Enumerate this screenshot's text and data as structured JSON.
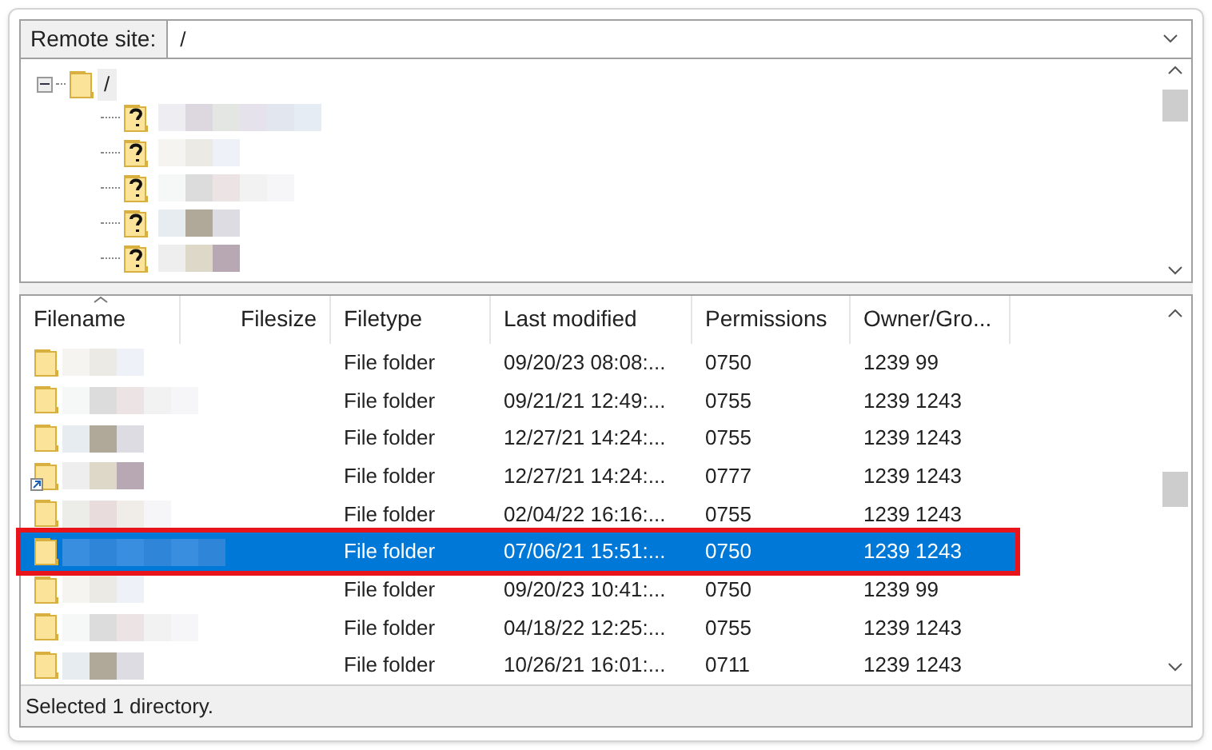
{
  "remote_site": {
    "label": "Remote site:",
    "value": "/"
  },
  "tree": {
    "root": {
      "label": "/",
      "expanded": true,
      "children": [
        {
          "kind": "unknown"
        },
        {
          "kind": "unknown"
        },
        {
          "kind": "unknown"
        },
        {
          "kind": "unknown"
        },
        {
          "kind": "unknown"
        }
      ]
    }
  },
  "table": {
    "columns": [
      "Filename",
      "Filesize",
      "Filetype",
      "Last modified",
      "Permissions",
      "Owner/Gro..."
    ],
    "rows": [
      {
        "selected": false,
        "symlink": false,
        "filetype": "File folder",
        "last_modified": "09/20/23 08:08:...",
        "permissions": "0750",
        "owner": "1239 99"
      },
      {
        "selected": false,
        "symlink": false,
        "filetype": "File folder",
        "last_modified": "09/21/21 12:49:...",
        "permissions": "0755",
        "owner": "1239 1243"
      },
      {
        "selected": false,
        "symlink": false,
        "filetype": "File folder",
        "last_modified": "12/27/21 14:24:...",
        "permissions": "0755",
        "owner": "1239 1243"
      },
      {
        "selected": false,
        "symlink": true,
        "filetype": "File folder",
        "last_modified": "12/27/21 14:24:...",
        "permissions": "0777",
        "owner": "1239 1243"
      },
      {
        "selected": false,
        "symlink": false,
        "filetype": "File folder",
        "last_modified": "02/04/22 16:16:...",
        "permissions": "0755",
        "owner": "1239 1243"
      },
      {
        "selected": true,
        "symlink": false,
        "filetype": "File folder",
        "last_modified": "07/06/21 15:51:...",
        "permissions": "0750",
        "owner": "1239 1243"
      },
      {
        "selected": false,
        "symlink": false,
        "filetype": "File folder",
        "last_modified": "09/20/23 10:41:...",
        "permissions": "0750",
        "owner": "1239 99"
      },
      {
        "selected": false,
        "symlink": false,
        "filetype": "File folder",
        "last_modified": "04/18/22 12:25:...",
        "permissions": "0755",
        "owner": "1239 1243"
      },
      {
        "selected": false,
        "symlink": false,
        "filetype": "File folder",
        "last_modified": "10/26/21 16:01:...",
        "permissions": "0711",
        "owner": "1239 1243"
      }
    ]
  },
  "status_bar": "Selected 1 directory."
}
